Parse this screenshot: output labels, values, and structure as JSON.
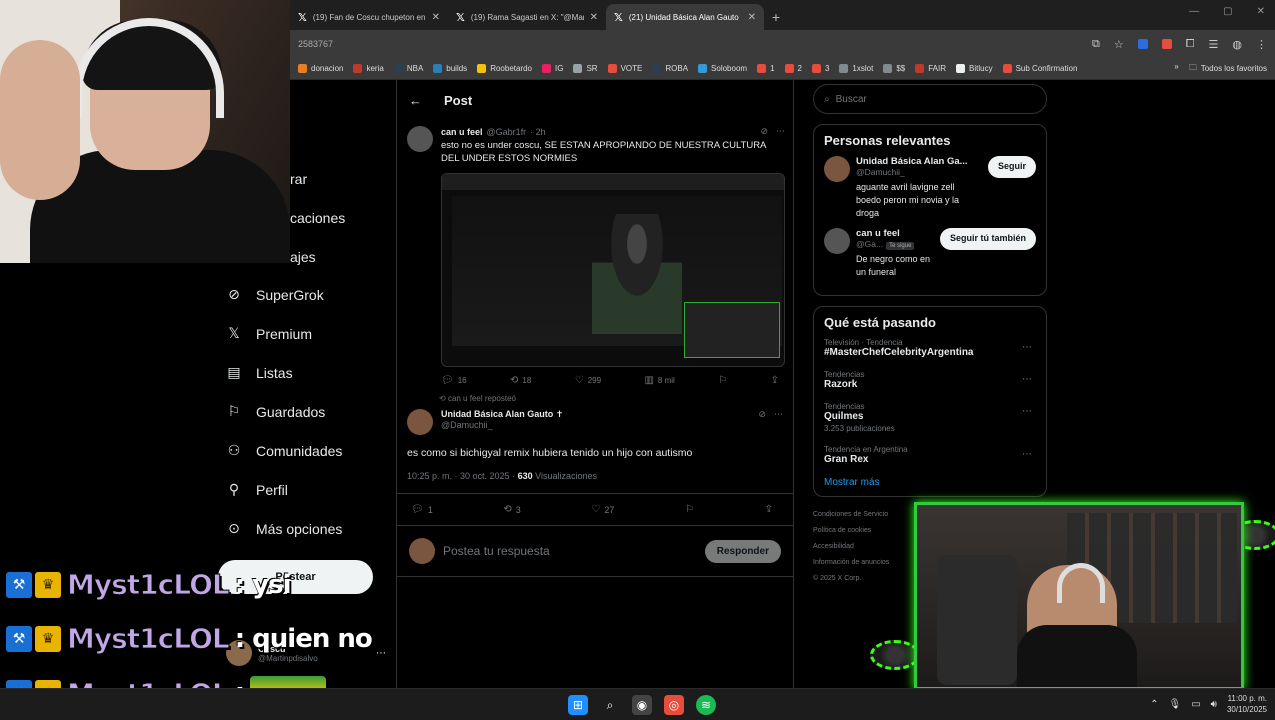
{
  "browser": {
    "tabs": [
      {
        "title": "(19) Fan de Coscu chupeton en",
        "active": false
      },
      {
        "title": "(19) Rama Sagasti en X: \"@Mar",
        "active": false
      },
      {
        "title": "(21) Unidad Básica Alan Gauto",
        "active": true
      }
    ],
    "url": "2583767",
    "bookmarks": [
      {
        "label": "donacion",
        "color": "#e67e22"
      },
      {
        "label": "keria",
        "color": "#c0392b"
      },
      {
        "label": "NBA",
        "color": "#2c3e50"
      },
      {
        "label": "builds",
        "color": "#2980b9"
      },
      {
        "label": "Roobetardo",
        "color": "#f1c40f"
      },
      {
        "label": "IG",
        "color": "#e91e63"
      },
      {
        "label": "SR",
        "color": "#95a5a6"
      },
      {
        "label": "VOTE",
        "color": "#e74c3c"
      },
      {
        "label": "ROBA",
        "color": "#2c3e50"
      },
      {
        "label": "Soloboom",
        "color": "#3498db"
      },
      {
        "label": "1",
        "color": "#e74c3c"
      },
      {
        "label": "2",
        "color": "#e74c3c"
      },
      {
        "label": "3",
        "color": "#e74c3c"
      },
      {
        "label": "1xslot",
        "color": "#7f8c8d"
      },
      {
        "label": "$$",
        "color": "#7f8c8d"
      },
      {
        "label": "FAIR",
        "color": "#c0392b"
      },
      {
        "label": "Bitlucy",
        "color": "#ecf0f1"
      },
      {
        "label": "Sub Confirmation",
        "color": "#e74c3c"
      }
    ],
    "bookmarks_overflow": "»",
    "all_bookmarks": "Todos los favoritos"
  },
  "nav": {
    "partial": [
      "rar",
      "caciones",
      "ajes"
    ],
    "items": [
      {
        "label": "SuperGrok",
        "icon": "⊘"
      },
      {
        "label": "Premium",
        "icon": "𝕏"
      },
      {
        "label": "Listas",
        "icon": "▤"
      },
      {
        "label": "Guardados",
        "icon": "🔖"
      },
      {
        "label": "Comunidades",
        "icon": "👥"
      },
      {
        "label": "Perfil",
        "icon": "👤"
      },
      {
        "label": "Más opciones",
        "icon": "⋯"
      }
    ],
    "post_button": "Postear",
    "account": {
      "name": "Coscu",
      "handle": "@Martinpdisalvo"
    }
  },
  "main": {
    "header": "Post",
    "tweet1": {
      "name": "can u feel",
      "handle": "@Gabr1fr",
      "time": "· 2h",
      "text": "esto no es under coscu, SE ESTAN APROPIANDO DE NUESTRA CULTURA DEL UNDER ESTOS NORMIES",
      "replies": "16",
      "reposts": "18",
      "likes": "299",
      "views": "8 mil"
    },
    "repost_note": "can u feel reposteó",
    "tweet2": {
      "name": "Unidad Básica Alan Gauto ✝",
      "handle": "@Damuchii_",
      "text": "es como si bichigyal remix hubiera tenido un hijo con autismo",
      "timestamp": "10:25 p. m. · 30 oct. 2025 ·",
      "views_count": "630",
      "views_label": "Visualizaciones",
      "replies": "1",
      "reposts": "3",
      "likes": "27"
    },
    "reply": {
      "placeholder": "Postea tu respuesta",
      "button": "Responder"
    }
  },
  "sidebar": {
    "search_placeholder": "Buscar",
    "relevant_title": "Personas relevantes",
    "people": [
      {
        "name": "Unidad Básica Alan Ga...",
        "handle": "@Damuchii_",
        "bio": "aguante avril lavigne zell boedo peron mi novia y la droga",
        "button": "Seguir",
        "badge": ""
      },
      {
        "name": "can u feel",
        "handle": "@Ga...",
        "bio": "De negro como en un funeral",
        "button": "Seguir tú también",
        "badge": "Te sigue"
      }
    ],
    "trends_title": "Qué está pasando",
    "trends": [
      {
        "category": "Televisión · Tendencia",
        "name": "#MasterChefCelebrityArgentina",
        "count": ""
      },
      {
        "category": "Tendencias",
        "name": "Razork",
        "count": ""
      },
      {
        "category": "Tendencias",
        "name": "Quilmes",
        "count": "3.253 publicaciones"
      },
      {
        "category": "Tendencia en Argentina",
        "name": "Gran Rex",
        "count": ""
      }
    ],
    "show_more": "Mostrar más",
    "footer": [
      "Condiciones de Servicio",
      "Política de cookies",
      "Accesibilidad",
      "Información de anuncios",
      "© 2025 X Corp."
    ]
  },
  "chat": [
    {
      "user": "Myst1cLOL",
      "message": ": ysi"
    },
    {
      "user": "Myst1cLOL",
      "message": ": quien no"
    },
    {
      "user": "Myst1cLOL",
      "message": ":"
    }
  ],
  "taskbar": {
    "time": "11:00 p. m.",
    "date": "30/10/2025"
  }
}
